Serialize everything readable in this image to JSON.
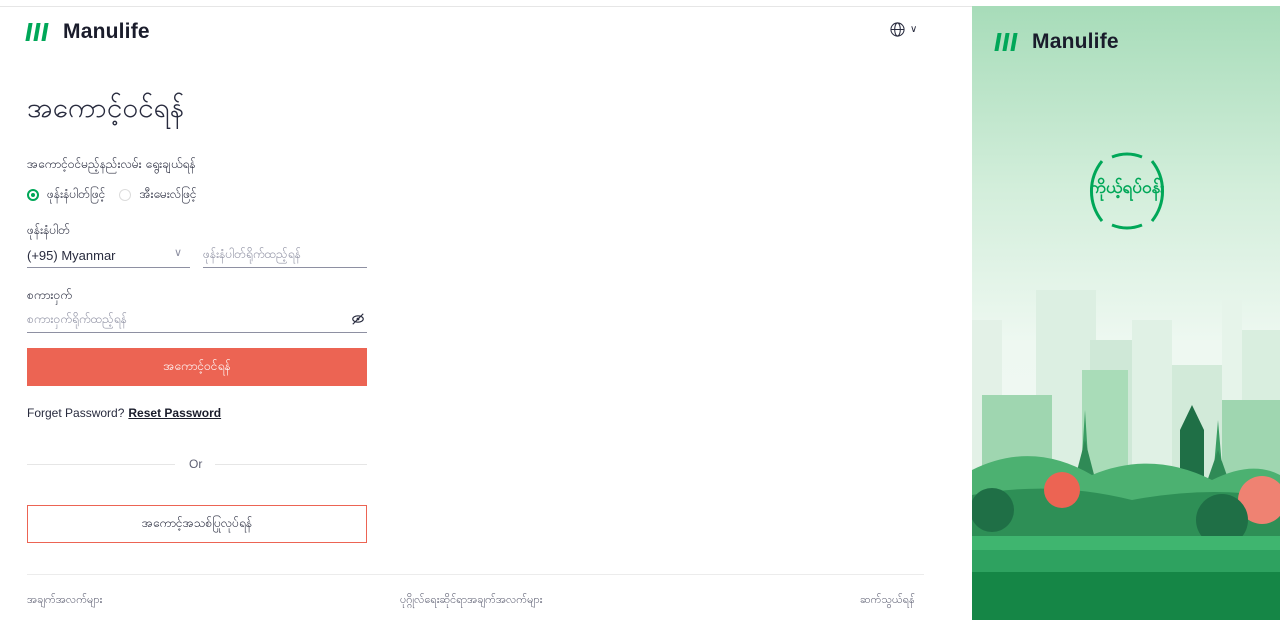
{
  "brand": {
    "name": "Manulife",
    "accent": "#00a758",
    "cta": "#ec6453"
  },
  "header": {
    "language_icon": "globe-icon"
  },
  "login": {
    "title": "အကောင့်ဝင်ရန်",
    "method_label": "အကောင့်ဝင်မည့်နည်းလမ်း ရွေးချယ်ရန်",
    "options": [
      {
        "label": "ဖုန်းနံပါတ်ဖြင့်",
        "selected": true
      },
      {
        "label": "အီးမေးလ်ဖြင့်",
        "selected": false
      }
    ],
    "phone": {
      "label": "ဖုန်းနံပါတ်",
      "country_value": "(+95) Myanmar",
      "placeholder": "ဖုန်းနံပါတ်ရိုက်ထည့်ရန်"
    },
    "password": {
      "label": "စကားဝှက်",
      "placeholder": "စကားဝှက်ရိုက်ထည့်ရန်",
      "toggle_icon": "eye-off-icon"
    },
    "submit_label": "အကောင့်ဝင်ရန်",
    "forgot_text": "Forget Password?",
    "reset_link": "Reset Password",
    "divider": "Or",
    "register_label": "အကောင့်အသစ်ပြုလုပ်ရန်"
  },
  "footer": {
    "links": [
      "အချက်အလက်များ",
      "ပုဂ္ဂိုလ်ရေးဆိုင်ရာအချက်အလက်များ",
      "ဆက်သွယ်ရန်"
    ]
  },
  "promo": {
    "brand": "Manulife",
    "badge_text": "ကိုယ့်ရပ်ဝန်း"
  }
}
